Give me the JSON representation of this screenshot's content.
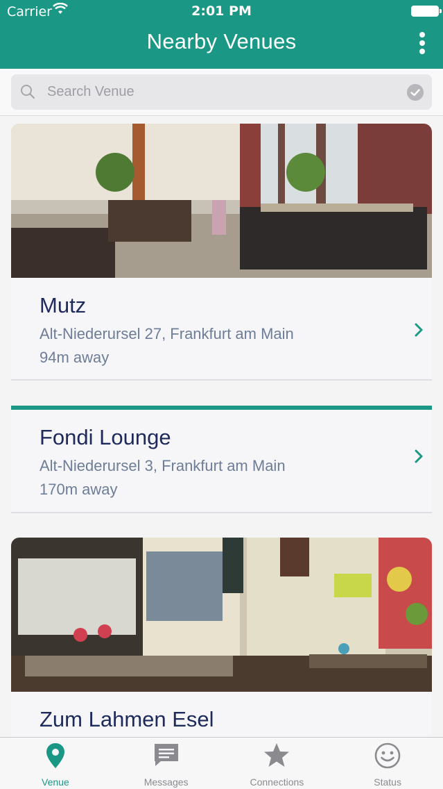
{
  "status_bar": {
    "carrier": "Carrier",
    "time": "2:01 PM"
  },
  "header": {
    "title": "Nearby Venues",
    "menu_icon": "more-vertical-icon"
  },
  "search": {
    "placeholder": "Search Venue",
    "value": ""
  },
  "venues": [
    {
      "name": "Mutz",
      "address": "Alt-Niederursel 27, Frankfurt am Main",
      "distance": "94m away",
      "has_image": true
    },
    {
      "name": "Fondi Lounge",
      "address": "Alt-Niederursel 3, Frankfurt am Main",
      "distance": "170m away",
      "has_image": false
    },
    {
      "name": "Zum Lahmen Esel",
      "address": "",
      "distance": "",
      "has_image": true
    }
  ],
  "tabs": [
    {
      "label": "Venue",
      "icon": "map-pin-icon",
      "active": true
    },
    {
      "label": "Messages",
      "icon": "message-icon",
      "active": false
    },
    {
      "label": "Connections",
      "icon": "star-icon",
      "active": false
    },
    {
      "label": "Status",
      "icon": "smiley-icon",
      "active": false
    }
  ],
  "colors": {
    "accent": "#1a9885",
    "venue_name": "#1e2a5b",
    "venue_meta": "#6d7d97"
  }
}
